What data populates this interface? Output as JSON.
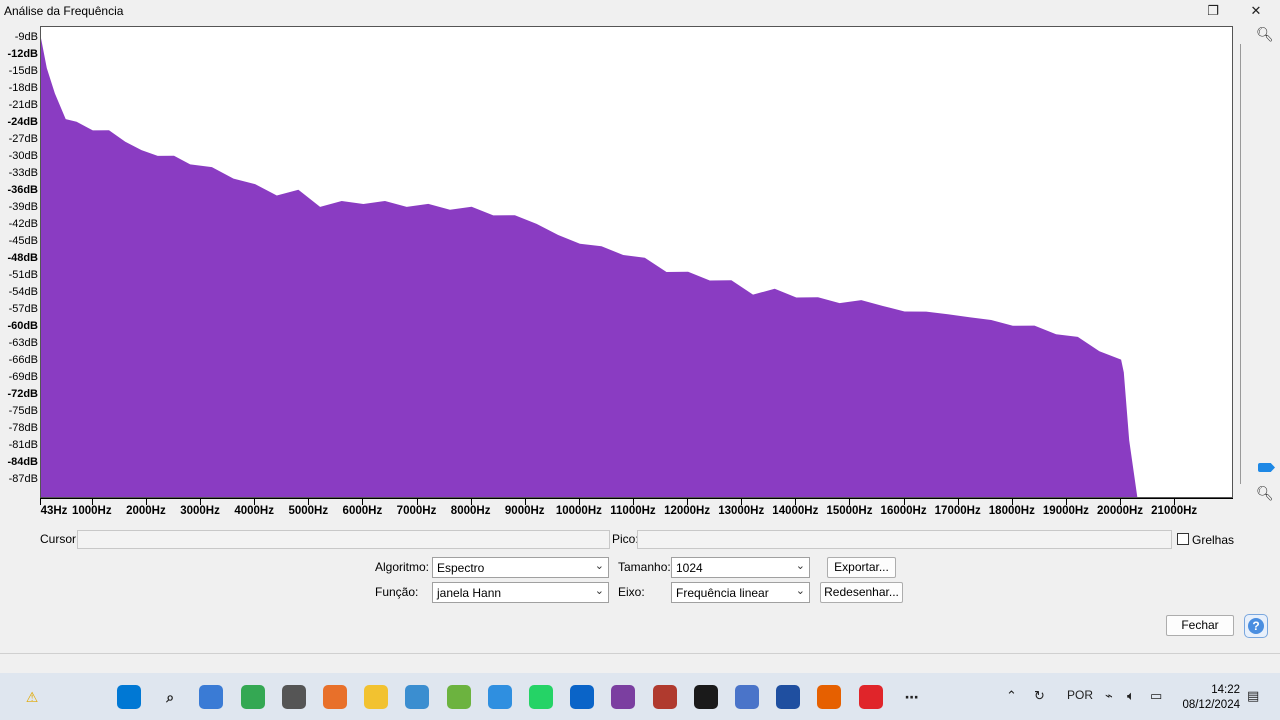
{
  "window": {
    "title": "Análise da Frequência",
    "restore_icon": "restore-icon",
    "close_icon": "close-icon"
  },
  "colors": {
    "spectrum_fill": "#8a3cc2",
    "plot_bg": "#ffffff",
    "accent": "#1e88e5"
  },
  "chart_data": {
    "type": "area",
    "title": "",
    "xlabel": "",
    "ylabel": "",
    "xlim": [
      43,
      22050
    ],
    "ylim": [
      -90,
      -7
    ],
    "y_ticks": [
      "-9dB",
      "-12dB",
      "-15dB",
      "-18dB",
      "-21dB",
      "-24dB",
      "-27dB",
      "-30dB",
      "-33dB",
      "-36dB",
      "-39dB",
      "-42dB",
      "-45dB",
      "-48dB",
      "-51dB",
      "-54dB",
      "-57dB",
      "-60dB",
      "-63dB",
      "-66dB",
      "-69dB",
      "-72dB",
      "-75dB",
      "-78dB",
      "-81dB",
      "-84dB",
      "-87dB"
    ],
    "x_ticks": [
      "43Hz",
      "1000Hz",
      "2000Hz",
      "3000Hz",
      "4000Hz",
      "5000Hz",
      "6000Hz",
      "7000Hz",
      "8000Hz",
      "9000Hz",
      "10000Hz",
      "11000Hz",
      "12000Hz",
      "13000Hz",
      "14000Hz",
      "15000Hz",
      "16000Hz",
      "17000Hz",
      "18000Hz",
      "19000Hz",
      "20000Hz",
      "21000Hz"
    ],
    "series": [
      {
        "x": [
          43,
          150,
          300,
          500,
          700,
          1000,
          1300,
          1600,
          1900,
          2200,
          2500,
          2800,
          3200,
          3600,
          4000,
          4400,
          4800,
          5200,
          5600,
          6000,
          6400,
          6800,
          7200,
          7600,
          8000,
          8400,
          8800,
          9200,
          9600,
          10000,
          10400,
          10800,
          11200,
          11600,
          12000,
          12400,
          12800,
          13200,
          13600,
          14000,
          14400,
          14800,
          15200,
          15600,
          16000,
          16400,
          16800,
          17200,
          17600,
          18000,
          18400,
          18800,
          19200,
          19600,
          20000,
          20050,
          20150,
          20300
        ],
        "values": [
          -9,
          -14,
          -19,
          -23,
          -24,
          -25,
          -25.5,
          -27,
          -29,
          -29.5,
          -30,
          -31,
          -32,
          -33.5,
          -35,
          -36.5,
          -36,
          -38.5,
          -38,
          -38,
          -38,
          -38.5,
          -38.5,
          -39,
          -39,
          -40,
          -40.5,
          -41.5,
          -44,
          -45,
          -46,
          -47,
          -48,
          -50,
          -50.5,
          -51.5,
          -52,
          -54,
          -53.5,
          -54.5,
          -55,
          -55.5,
          -55.5,
          -56,
          -57.5,
          -57,
          -58,
          -58,
          -59,
          -59.5,
          -60,
          -61,
          -62,
          -64,
          -66,
          -68,
          -80,
          -90
        ]
      }
    ]
  },
  "cursor": {
    "label": "Cursor:",
    "value": ""
  },
  "peak": {
    "label": "Pico:",
    "value": ""
  },
  "grid_checkbox": {
    "label": "Grelhas",
    "checked": false
  },
  "controls": {
    "algorithm_label": "Algoritmo:",
    "algorithm_value": "Espectro",
    "size_label": "Tamanho:",
    "size_value": "1024",
    "export_button": "Exportar...",
    "function_label": "Função:",
    "function_value": "janela Hann",
    "axis_label": "Eixo:",
    "axis_value": "Frequência linear",
    "redraw_button": "Redesenhar..."
  },
  "close_button": "Fechar",
  "help_button": "?",
  "taskbar": {
    "icons": [
      "warning-icon",
      "start-icon",
      "search-icon",
      "widgets-icon",
      "chrome-icon",
      "calculator-icon",
      "media-player-icon",
      "file-explorer-icon",
      "settings-app-icon",
      "utorrent-icon",
      "unknown-app-icon",
      "whatsapp-icon",
      "outlook-icon",
      "podcast-icon",
      "winrar-icon",
      "audacity-icon",
      "plane-icon",
      "arc-icon",
      "firefox-icon",
      "anydesk-icon",
      "more-icon"
    ],
    "tray_language": "POR",
    "time": "14:22",
    "date": "08/12/2024"
  }
}
